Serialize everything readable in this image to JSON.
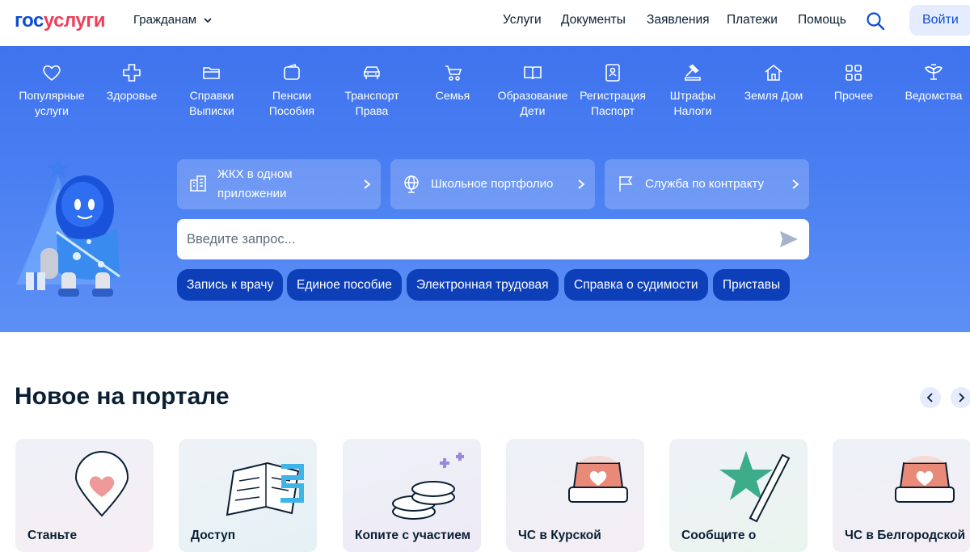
{
  "header": {
    "logo_part1": "гос",
    "logo_part2": "услуги",
    "audience": "Гражданам",
    "nav": [
      "Услуги",
      "Документы",
      "Заявления",
      "Платежи",
      "Помощь"
    ],
    "login": "Войти"
  },
  "categories": [
    {
      "l1": "Популярные",
      "l2": "услуги",
      "icon": "heart-icon"
    },
    {
      "l1": "Здоровье",
      "l2": "",
      "icon": "plus-cross-icon"
    },
    {
      "l1": "Справки",
      "l2": "Выписки",
      "icon": "folder-icon"
    },
    {
      "l1": "Пенсии",
      "l2": "Пособия",
      "icon": "wallet-icon"
    },
    {
      "l1": "Транспорт",
      "l2": "Права",
      "icon": "car-icon"
    },
    {
      "l1": "Семья",
      "l2": "",
      "icon": "stroller-icon"
    },
    {
      "l1": "Образование",
      "l2": "Дети",
      "icon": "book-icon"
    },
    {
      "l1": "Регистрация",
      "l2": "Паспорт",
      "icon": "passport-icon"
    },
    {
      "l1": "Штрафы",
      "l2": "Налоги",
      "icon": "gavel-icon"
    },
    {
      "l1": "Земля Дом",
      "l2": "",
      "icon": "house-icon"
    },
    {
      "l1": "Прочее",
      "l2": "",
      "icon": "grid-icon"
    },
    {
      "l1": "Ведомства",
      "l2": "",
      "icon": "eagle-icon"
    }
  ],
  "promos": [
    {
      "l1": "ЖКХ в одном",
      "l2": "приложении",
      "icon": "building-icon"
    },
    {
      "l1": "Школьное портфолио",
      "l2": "",
      "icon": "globe-icon"
    },
    {
      "l1": "Служба по контракту",
      "l2": "",
      "icon": "flag-icon"
    }
  ],
  "search": {
    "placeholder": "Введите запрос..."
  },
  "chips": [
    "Запись к врачу",
    "Единое пособие",
    "Электронная трудовая",
    "Справка о судимости",
    "Приставы"
  ],
  "news": {
    "title": "Новое на портале",
    "cards": [
      "Станьте",
      "Доступ",
      "Копите с участием",
      "ЧС в Курской",
      "Сообщите о",
      "ЧС в Белгородской"
    ]
  },
  "colors": {
    "brand_blue": "#0d4cd3",
    "brand_red": "#ee3f58",
    "chip_blue": "#0d3fb8",
    "hero_blue": "#4a7ff2"
  }
}
